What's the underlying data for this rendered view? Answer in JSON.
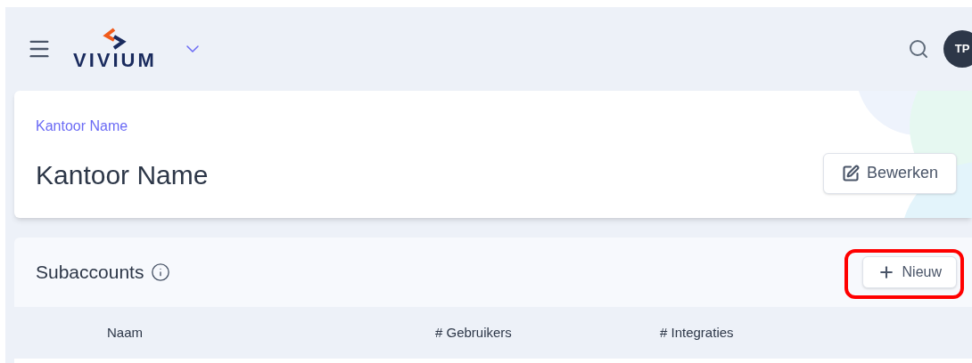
{
  "header": {
    "logo_text": "VIVIUM",
    "avatar_initials": "TP"
  },
  "office": {
    "breadcrumb": "Kantoor Name",
    "title": "Kantoor Name",
    "edit_button": "Bewerken"
  },
  "subaccounts": {
    "title": "Subaccounts",
    "new_button": {
      "label": "Nieuw",
      "highlighted": true
    },
    "table": {
      "columns": [
        "Naam",
        "# Gebruikers",
        "# Integraties"
      ]
    }
  }
}
